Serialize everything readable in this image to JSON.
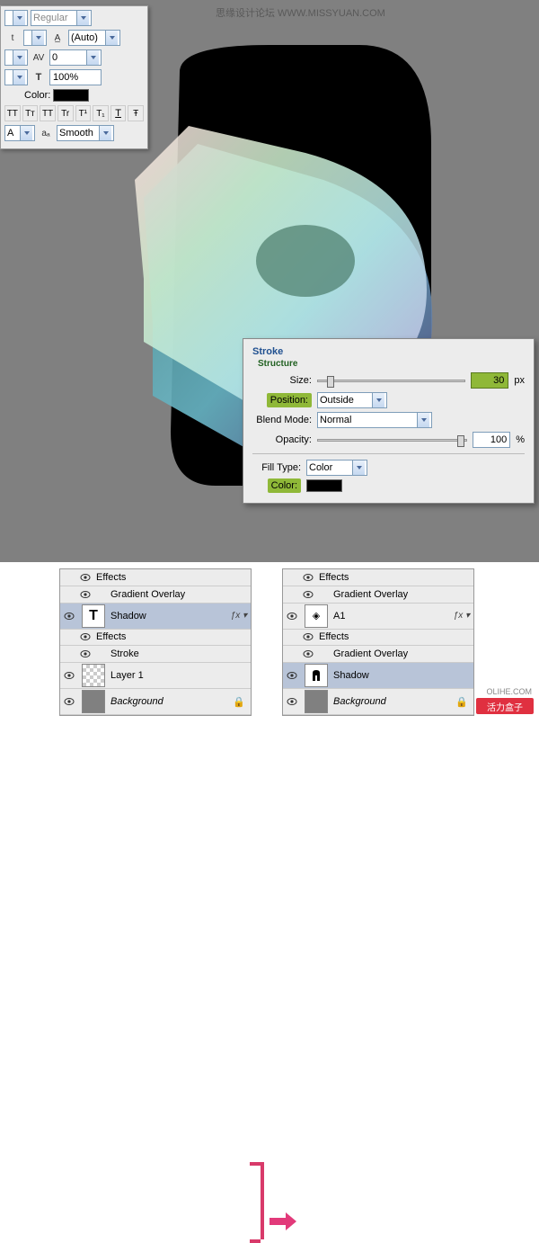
{
  "watermark": "思缘设计论坛  WWW.MISSYUAN.COM",
  "charPanel": {
    "fontStyle": "Regular",
    "leading": "(Auto)",
    "tracking": "0",
    "scale": "100%",
    "colorLabel": "Color:",
    "aa": "Smooth",
    "ttButtons": [
      "TT",
      "Tᴛ",
      "TT",
      "Tr",
      "T¹",
      "T₁",
      "T",
      "Ŧ"
    ],
    "aaLabel": "aₐ"
  },
  "strokeDlg": {
    "title": "Stroke",
    "sub": "Structure",
    "sizeLabel": "Size:",
    "sizeVal": "30",
    "sizeUnit": "px",
    "posLabel": "Position:",
    "posVal": "Outside",
    "blendLabel": "Blend Mode:",
    "blendVal": "Normal",
    "opLabel": "Opacity:",
    "opVal": "100",
    "opUnit": "%",
    "fillLabel": "Fill Type:",
    "fillVal": "Color",
    "colorLabel": "Color:"
  },
  "layersLeft": {
    "effects": "Effects",
    "grad": "Gradient Overlay",
    "shadow": "Shadow",
    "stroke": "Stroke",
    "layer1": "Layer 1",
    "bg": "Background"
  },
  "layersRight": {
    "effects": "Effects",
    "grad": "Gradient Overlay",
    "a1": "A1",
    "shadow": "Shadow",
    "bg": "Background"
  },
  "logo": "活力盒子",
  "sublogo": "OLIHE.COM"
}
